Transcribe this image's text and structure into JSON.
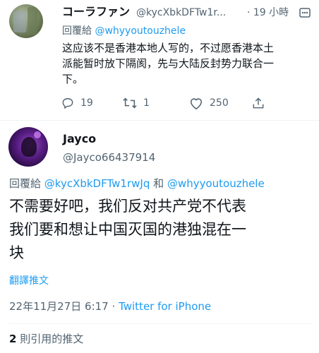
{
  "colors": {
    "link": "#1d9bf0",
    "muted": "#536471",
    "text": "#0f1419",
    "divider": "#eff3f4"
  },
  "reply_tweet": {
    "display_name": "コーラファン",
    "handle": "@kycXbkDFTw1r...",
    "time": "· 19 小時",
    "reply_prefix": "回覆給",
    "reply_to": "@whyyoutouzhele",
    "text_lines": [
      "这应该不是香港本地人写的，不过愿香港本土",
      "派能暂时放下隔阂，先与大陆反封势力联合一",
      "下。"
    ],
    "replies": "19",
    "retweets": "1",
    "likes": "250",
    "icons": [
      "more-icon",
      "reply-icon",
      "retweet-icon",
      "like-icon",
      "share-icon"
    ]
  },
  "main_tweet": {
    "display_name": "Jayco",
    "handle": "@Jayco66437914",
    "reply_prefix": "回覆給",
    "reply_to_1": "@kycXbkDFTw1rwJq",
    "reply_and": "和",
    "reply_to_2": "@whyyoutouzhele",
    "text_lines": [
      "不需要好吧，我们反对共产党不代表",
      "我们要和想让中国灭国的港独混在一",
      "块"
    ],
    "translate": "翻譯推文",
    "date": "22年11月27日 6:17",
    "dot": "·",
    "client": "Twitter for iPhone",
    "quotes_count": "2",
    "quotes_label": "則引用的推文"
  }
}
